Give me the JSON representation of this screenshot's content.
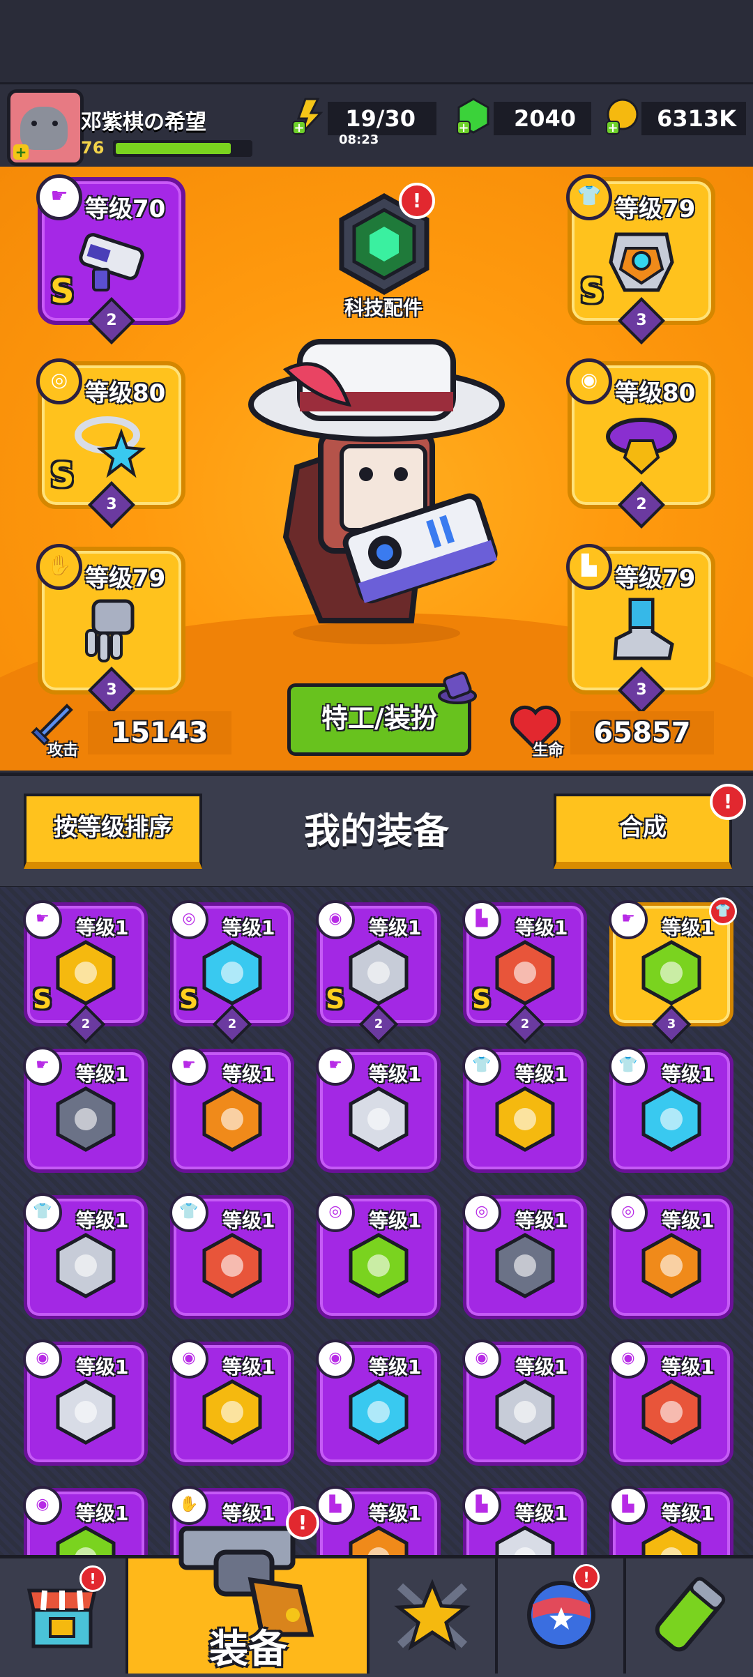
{
  "player": {
    "name": "邓紫棋の希望",
    "level": "76",
    "xp_fraction": 0.86
  },
  "resources": {
    "energy": {
      "value": "19/30",
      "timer": "08:23",
      "color": "#f5c518"
    },
    "gems": {
      "value": "2040",
      "color": "#3bd23a"
    },
    "coins": {
      "value": "6313K",
      "color": "#f5b90f"
    }
  },
  "tech_part": {
    "label": "科技配件",
    "badge": "!"
  },
  "slots": {
    "weapon": {
      "level": "等级70",
      "grade": "S",
      "stars": "2",
      "type_icon": "weapon-icon"
    },
    "armor": {
      "level": "等级79",
      "grade": "S",
      "stars": "3",
      "type_icon": "armor-icon"
    },
    "necklace": {
      "level": "等级80",
      "grade": "S",
      "stars": "3",
      "type_icon": "necklace-icon"
    },
    "belt": {
      "level": "等级80",
      "grade": "",
      "stars": "2",
      "type_icon": "belt-icon"
    },
    "gloves": {
      "level": "等级79",
      "grade": "",
      "stars": "3",
      "type_icon": "gloves-icon"
    },
    "boots": {
      "level": "等级79",
      "grade": "",
      "stars": "3",
      "type_icon": "boots-icon"
    }
  },
  "agent_button": {
    "label": "特工/装扮"
  },
  "stats": {
    "attack": {
      "label": "攻击",
      "value": "15143"
    },
    "health": {
      "label": "生命",
      "value": "65857"
    }
  },
  "equipment": {
    "title": "我的装备",
    "sort_button": "按等级排序",
    "merge_button": "合成",
    "merge_badge": "!",
    "items": [
      {
        "level": "等级1",
        "grade": "S",
        "stars": "2",
        "type": "weapon",
        "icon": "sword-icon",
        "rarity": "purple"
      },
      {
        "level": "等级1",
        "grade": "S",
        "stars": "2",
        "type": "necklace",
        "icon": "star-necklace-icon",
        "rarity": "purple"
      },
      {
        "level": "等级1",
        "grade": "S",
        "stars": "2",
        "type": "belt",
        "icon": "gold-belt-icon",
        "rarity": "purple"
      },
      {
        "level": "等级1",
        "grade": "S",
        "stars": "2",
        "type": "boots",
        "icon": "boots-icon",
        "rarity": "purple"
      },
      {
        "level": "等级1",
        "grade": "",
        "stars": "3",
        "type": "weapon",
        "icon": "kunai-icon",
        "rarity": "gold",
        "badge": true
      },
      {
        "level": "等级1",
        "grade": "",
        "stars": "",
        "type": "weapon",
        "icon": "revolver-icon",
        "rarity": "purple"
      },
      {
        "level": "等级1",
        "grade": "",
        "stars": "",
        "type": "weapon",
        "icon": "shotgun-icon",
        "rarity": "purple"
      },
      {
        "level": "等级1",
        "grade": "",
        "stars": "",
        "type": "weapon",
        "icon": "drill-icon",
        "rarity": "purple"
      },
      {
        "level": "等级1",
        "grade": "",
        "stars": "",
        "type": "armor",
        "icon": "green-armor-icon",
        "rarity": "purple"
      },
      {
        "level": "等级1",
        "grade": "",
        "stars": "",
        "type": "armor",
        "icon": "steel-armor-icon",
        "rarity": "purple"
      },
      {
        "level": "等级1",
        "grade": "",
        "stars": "",
        "type": "armor",
        "icon": "vest-icon",
        "rarity": "purple"
      },
      {
        "level": "等级1",
        "grade": "",
        "stars": "",
        "type": "armor",
        "icon": "vest-icon",
        "rarity": "purple"
      },
      {
        "level": "等级1",
        "grade": "",
        "stars": "",
        "type": "necklace",
        "icon": "fang-necklace-icon",
        "rarity": "purple"
      },
      {
        "level": "等级1",
        "grade": "",
        "stars": "",
        "type": "necklace",
        "icon": "spike-collar-icon",
        "rarity": "purple"
      },
      {
        "level": "等级1",
        "grade": "",
        "stars": "",
        "type": "necklace",
        "icon": "emerald-necklace-icon",
        "rarity": "purple"
      },
      {
        "level": "等级1",
        "grade": "",
        "stars": "",
        "type": "belt",
        "icon": "rope-belt-icon",
        "rarity": "purple"
      },
      {
        "level": "等级1",
        "grade": "",
        "stars": "",
        "type": "belt",
        "icon": "gem-belt-icon",
        "rarity": "purple"
      },
      {
        "level": "等级1",
        "grade": "",
        "stars": "",
        "type": "belt",
        "icon": "purple-belt-icon",
        "rarity": "purple"
      },
      {
        "level": "等级1",
        "grade": "",
        "stars": "",
        "type": "belt",
        "icon": "star-belt-icon",
        "rarity": "purple"
      },
      {
        "level": "等级1",
        "grade": "",
        "stars": "",
        "type": "belt",
        "icon": "star-belt-icon",
        "rarity": "purple"
      },
      {
        "level": "等级1",
        "grade": "",
        "stars": "",
        "type": "belt",
        "icon": "belt-icon",
        "rarity": "purple"
      },
      {
        "level": "等级1",
        "grade": "",
        "stars": "",
        "type": "gloves",
        "icon": "glove-icon",
        "rarity": "purple"
      },
      {
        "level": "等级1",
        "grade": "",
        "stars": "",
        "type": "boots",
        "icon": "boot-icon",
        "rarity": "purple"
      },
      {
        "level": "等级1",
        "grade": "",
        "stars": "",
        "type": "boots",
        "icon": "boot-icon",
        "rarity": "purple"
      },
      {
        "level": "等级1",
        "grade": "",
        "stars": "",
        "type": "boots",
        "icon": "boot-icon",
        "rarity": "purple"
      }
    ]
  },
  "nav": {
    "shop": {
      "icon": "shop-icon",
      "badge": "!"
    },
    "equip": {
      "label": "装备",
      "icon": "revolver-icon",
      "badge": "!"
    },
    "battle": {
      "icon": "battle-star-icon"
    },
    "events": {
      "icon": "orb-icon",
      "badge": "!"
    },
    "lab": {
      "icon": "dna-capsule-icon"
    }
  }
}
